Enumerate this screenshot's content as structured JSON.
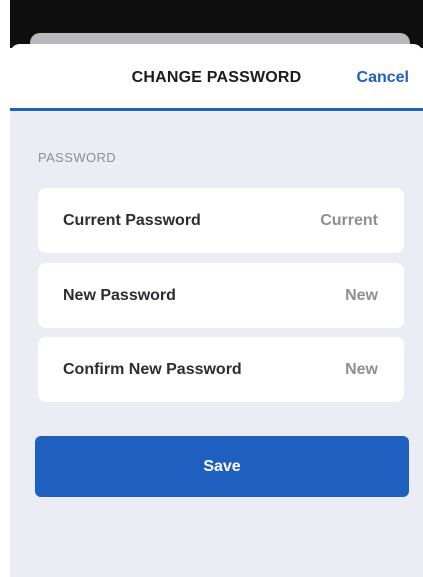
{
  "header": {
    "title": "CHANGE PASSWORD",
    "cancel_label": "Cancel"
  },
  "section": {
    "label": "PASSWORD"
  },
  "fields": [
    {
      "label": "Current Password",
      "placeholder": "Current",
      "value": ""
    },
    {
      "label": "New Password",
      "placeholder": "New",
      "value": ""
    },
    {
      "label": "Confirm New Password",
      "placeholder": "New",
      "value": ""
    }
  ],
  "actions": {
    "save_label": "Save"
  },
  "colors": {
    "accent": "#1f5fbf",
    "background": "#ececf5",
    "card": "#ffffff"
  }
}
